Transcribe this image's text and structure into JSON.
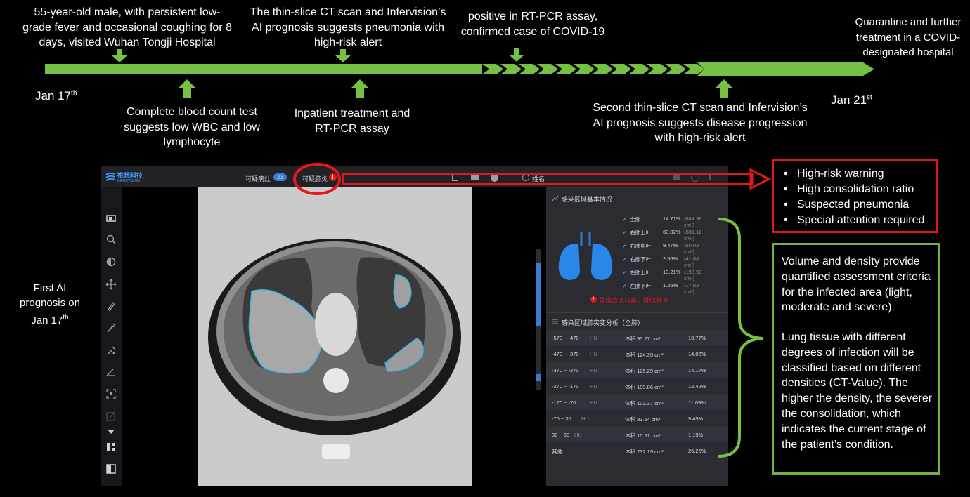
{
  "timeline": {
    "start_date": "Jan 17",
    "start_sup": "th",
    "end_date": "Jan 21",
    "end_sup": "st",
    "colors": {
      "line": "#76c043",
      "red": "#e0191c",
      "box_green": "#6cb33f"
    }
  },
  "notes": {
    "visit": "55-year-old male, with persistent low-grade fever and occasional coughing for 8 days, visited Wuhan Tongji Hospital",
    "ct1": "The thin-slice CT scan and Infervision’s AI prognosis suggests pneumonia with high-risk alert",
    "rtpcr": "positive in RT-PCR assay, confirmed case of COVID-19",
    "quarantine": "Quarantine and further treatment in a COVID-designated hospital",
    "blood": "Complete blood count test suggests low WBC and low lymphocyte",
    "inpatient": "Inpatient treatment and RT-PCR assay",
    "ct2": "Second thin-slice CT scan and Infervision’s AI prognosis suggests disease progression with high-risk alert",
    "first_ai_line1": "First AI",
    "first_ai_line2": "prognosis on",
    "first_ai_line3": "Jan 17",
    "first_ai_sup": "th"
  },
  "app": {
    "logo": "推想科技",
    "logo_sub": "INFERVISION",
    "tab_suspected_lesion": "可疑病灶",
    "lesion_count": "23",
    "tab_suspected_pneumonia": "可疑肺炎",
    "user_name": "姓名",
    "panel_title": "感染区域基本情况",
    "lobes": [
      {
        "name": "全肺",
        "pct": "14.71%",
        "vol": "(884.38 cm³)"
      },
      {
        "name": "右肺上叶",
        "pct": "60.02%",
        "vol": "(581.11 cm³)"
      },
      {
        "name": "右肺中叶",
        "pct": "9.47%",
        "vol": "(50.02 cm³)"
      },
      {
        "name": "右肺下叶",
        "pct": "2.56%",
        "vol": "(41.84 cm³)"
      },
      {
        "name": "左肺上叶",
        "pct": "13.21%",
        "vol": "(193.59 cm³)"
      },
      {
        "name": "左肺下叶",
        "pct": "1.26%",
        "vol": "(17.82 cm³)"
      }
    ],
    "alert": "异常占比较高，疑似肺炎",
    "density_title": "感染区域肺实变分析（全肺）",
    "hu_rows": [
      {
        "range": "-570 ~ -470",
        "unit": "HU",
        "vol": "体积 95.27 cm³",
        "pct": "10.77%"
      },
      {
        "range": "-470 ~ -370",
        "unit": "HU",
        "vol": "体积 124.35 cm³",
        "pct": "14.06%"
      },
      {
        "range": "-370 ~ -270",
        "unit": "HU",
        "vol": "体积 125.29 cm³",
        "pct": "14.17%"
      },
      {
        "range": "-270 ~ -170",
        "unit": "HU",
        "vol": "体积 109.86 cm³",
        "pct": "12.42%"
      },
      {
        "range": "-170 ~ -70",
        "unit": "HU",
        "vol": "体积 103.37 cm³",
        "pct": "11.69%"
      },
      {
        "range": "-70 ~ 30",
        "unit": "HU",
        "vol": "体积 83.54 cm³",
        "pct": "9.45%"
      },
      {
        "range": "30 ~ 60",
        "unit": "HU",
        "vol": "体积 10.51 cm³",
        "pct": "1.19%"
      },
      {
        "range": "其他",
        "unit": "",
        "vol": "体积 232.19 cm³",
        "pct": "26.25%"
      }
    ]
  },
  "red_box": {
    "items": [
      "High-risk warning",
      "High consolidation ratio",
      "Suspected pneumonia",
      "Special attention required"
    ]
  },
  "green_box": {
    "para1": "Volume and density provide quantified assessment criteria for the infected area (light, moderate and severe).",
    "para2": "Lung tissue with different degrees of infection will be classified based on different densities (CT-Value). The higher the density, the severer the consolidation, which indicates the current stage of the patient’s condition."
  }
}
